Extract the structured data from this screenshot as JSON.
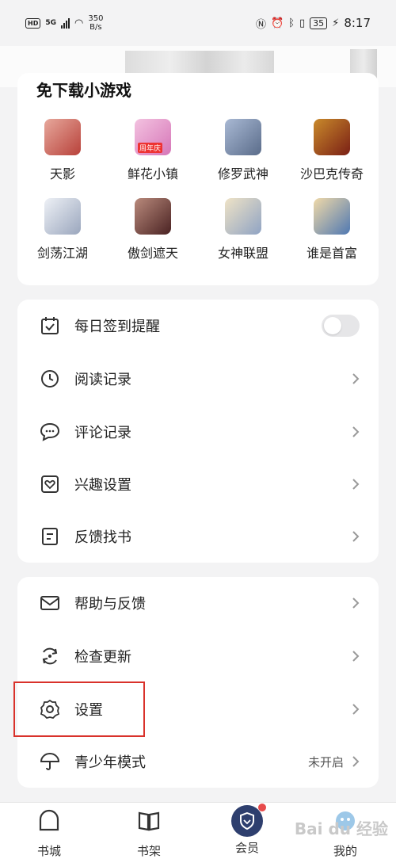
{
  "status_bar": {
    "hd": "HD",
    "network": "5G",
    "speed_value": "350",
    "speed_unit": "B/s",
    "battery": "35",
    "time": "8:17"
  },
  "games": {
    "title": "免下载小游戏",
    "items": [
      {
        "name": "天影",
        "color": "#b8413a"
      },
      {
        "name": "鲜花小镇",
        "color": "#d676b8",
        "badge": "周年庆"
      },
      {
        "name": "修罗武神",
        "color": "#5a6c8a"
      },
      {
        "name": "沙巴克传奇",
        "color": "#7a1f15"
      },
      {
        "name": "剑荡江湖",
        "color": "#bfc8d8"
      },
      {
        "name": "傲剑遮天",
        "color": "#6a3a3a"
      },
      {
        "name": "女神联盟",
        "color": "#c6b08a"
      },
      {
        "name": "谁是首富",
        "color": "#4f78b2"
      }
    ]
  },
  "menu_group1": [
    {
      "label": "每日签到提醒",
      "icon": "calendar-check-icon",
      "type": "toggle",
      "enabled": false
    },
    {
      "label": "阅读记录",
      "icon": "clock-icon",
      "type": "chevron"
    },
    {
      "label": "评论记录",
      "icon": "comment-icon",
      "type": "chevron"
    },
    {
      "label": "兴趣设置",
      "icon": "heart-icon",
      "type": "chevron"
    },
    {
      "label": "反馈找书",
      "icon": "document-icon",
      "type": "chevron"
    }
  ],
  "menu_group2": [
    {
      "label": "帮助与反馈",
      "icon": "mail-icon",
      "type": "chevron"
    },
    {
      "label": "检查更新",
      "icon": "refresh-icon",
      "type": "chevron"
    },
    {
      "label": "设置",
      "icon": "gear-icon",
      "type": "chevron"
    },
    {
      "label": "青少年模式",
      "icon": "umbrella-icon",
      "type": "chevron",
      "status": "未开启"
    }
  ],
  "bottom_nav": [
    {
      "label": "书城",
      "icon": "house-icon"
    },
    {
      "label": "书架",
      "icon": "book-icon"
    },
    {
      "label": "会员",
      "icon": "vip-shield-icon"
    },
    {
      "label": "我的",
      "icon": "profile-icon"
    }
  ],
  "watermark": "Bai du 经验",
  "colors": {
    "highlight": "#d9322b",
    "vip": "#2e3f6e"
  }
}
